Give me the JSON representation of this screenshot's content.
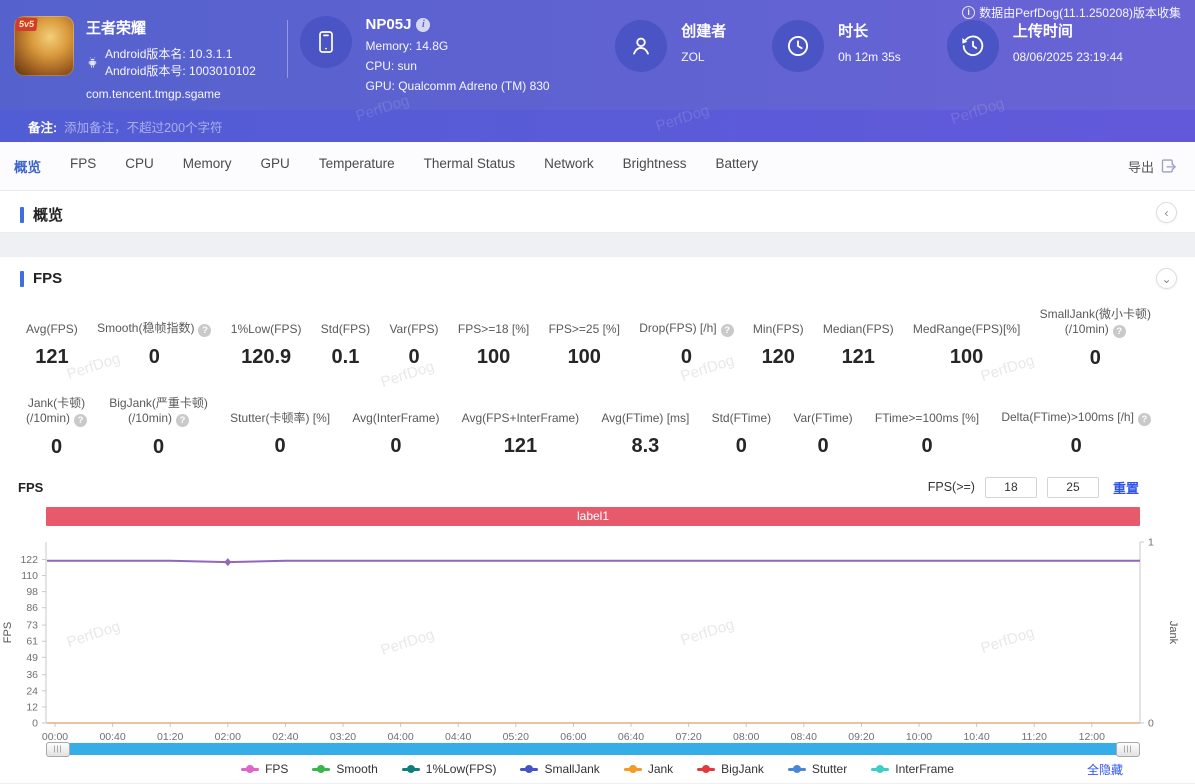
{
  "page": {
    "watermark": "PerfDog"
  },
  "header": {
    "app": {
      "name": "王者荣耀",
      "badge": "5v5",
      "android_version_name": "Android版本名: 10.3.1.1",
      "android_version_code": "Android版本号: 1003010102",
      "package": "com.tencent.tmgp.sgame"
    },
    "device": {
      "model": "NP05J",
      "memory": "Memory: 14.8G",
      "cpu": "CPU: sun",
      "gpu": "GPU: Qualcomm Adreno (TM) 830"
    },
    "creator": {
      "label": "创建者",
      "value": "ZOL"
    },
    "duration": {
      "label": "时长",
      "value": "0h 12m 35s"
    },
    "upload": {
      "label": "上传时间",
      "value": "08/06/2025 23:19:44"
    },
    "collect_note": "数据由PerfDog(11.1.250208)版本收集"
  },
  "note_bar": {
    "label": "备注:",
    "placeholder": "添加备注，不超过200个字符"
  },
  "tabs": {
    "items": [
      "概览",
      "FPS",
      "CPU",
      "Memory",
      "GPU",
      "Temperature",
      "Thermal Status",
      "Network",
      "Brightness",
      "Battery"
    ],
    "active": "概览",
    "export_label": "导出"
  },
  "sections": {
    "overview_title": "概览",
    "fps_title": "FPS"
  },
  "fps_stats_row1": [
    {
      "lines": [
        "Avg(FPS)"
      ],
      "help": false,
      "value": "121"
    },
    {
      "lines": [
        "Smooth(稳帧指数)"
      ],
      "help": true,
      "value": "0"
    },
    {
      "lines": [
        "1%Low(FPS)"
      ],
      "help": false,
      "value": "120.9"
    },
    {
      "lines": [
        "Std(FPS)"
      ],
      "help": false,
      "value": "0.1"
    },
    {
      "lines": [
        "Var(FPS)"
      ],
      "help": false,
      "value": "0"
    },
    {
      "lines": [
        "FPS>=18 [%]"
      ],
      "help": false,
      "value": "100"
    },
    {
      "lines": [
        "FPS>=25 [%]"
      ],
      "help": false,
      "value": "100"
    },
    {
      "lines": [
        "Drop(FPS) [/h]"
      ],
      "help": true,
      "value": "0"
    },
    {
      "lines": [
        "Min(FPS)"
      ],
      "help": false,
      "value": "120"
    },
    {
      "lines": [
        "Median(FPS)"
      ],
      "help": false,
      "value": "121"
    },
    {
      "lines": [
        "MedRange(FPS)[%]"
      ],
      "help": false,
      "value": "100"
    },
    {
      "lines": [
        "SmallJank(微小卡顿)",
        "(/10min)"
      ],
      "help": true,
      "value": "0"
    }
  ],
  "fps_stats_row2": [
    {
      "lines": [
        "Jank(卡顿)",
        "(/10min)"
      ],
      "help": true,
      "value": "0"
    },
    {
      "lines": [
        "BigJank(严重卡顿)",
        "(/10min)"
      ],
      "help": true,
      "value": "0"
    },
    {
      "lines": [
        "Stutter(卡顿率) [%]"
      ],
      "help": false,
      "value": "0"
    },
    {
      "lines": [
        "Avg(InterFrame)"
      ],
      "help": false,
      "value": "0"
    },
    {
      "lines": [
        "Avg(FPS+InterFrame)"
      ],
      "help": false,
      "value": "121"
    },
    {
      "lines": [
        "Avg(FTime) [ms]"
      ],
      "help": false,
      "value": "8.3"
    },
    {
      "lines": [
        "Std(FTime)"
      ],
      "help": false,
      "value": "0"
    },
    {
      "lines": [
        "Var(FTime)"
      ],
      "help": false,
      "value": "0"
    },
    {
      "lines": [
        "FTime>=100ms [%]"
      ],
      "help": false,
      "value": "0"
    },
    {
      "lines": [
        "Delta(FTime)>100ms [/h]"
      ],
      "help": true,
      "value": "0"
    }
  ],
  "fps_chart": {
    "title": "FPS",
    "threshold_label": "FPS(>=)",
    "threshold_values": [
      "18",
      "25"
    ],
    "reset_label": "重置",
    "hide_all_label": "全隐藏"
  },
  "chart_data": {
    "type": "line",
    "title": "FPS",
    "label_bar": "label1",
    "x_ticks": [
      "00:00",
      "00:40",
      "01:20",
      "02:00",
      "02:40",
      "03:20",
      "04:00",
      "04:40",
      "05:20",
      "06:00",
      "06:40",
      "07:20",
      "08:00",
      "08:40",
      "09:20",
      "10:00",
      "10:40",
      "11:20",
      "12:00"
    ],
    "y_left": {
      "label": "FPS",
      "ticks": [
        0,
        12,
        24,
        36,
        49,
        61,
        73,
        86,
        98,
        110,
        122
      ],
      "max": 135
    },
    "y_right": {
      "label": "Jank",
      "ticks": [
        0,
        1
      ],
      "max": 1
    },
    "grid": false,
    "series": [
      {
        "name": "FPS",
        "axis": "left",
        "color": "#9266bd",
        "values": [
          121,
          121,
          121,
          120,
          121,
          121,
          121,
          121,
          121,
          121,
          121,
          121,
          121,
          121,
          121,
          121,
          121,
          121,
          121
        ]
      },
      {
        "name": "Jank",
        "axis": "right",
        "color": "#e0b080",
        "values": [
          0,
          0,
          0,
          0,
          0,
          0,
          0,
          0,
          0,
          0,
          0,
          0,
          0,
          0,
          0,
          0,
          0,
          0,
          0
        ]
      }
    ],
    "legend": [
      {
        "name": "FPS",
        "color": "#e064c8"
      },
      {
        "name": "Smooth",
        "color": "#3cb44b"
      },
      {
        "name": "1%Low(FPS)",
        "color": "#0f7f7b"
      },
      {
        "name": "SmallJank",
        "color": "#4653c8"
      },
      {
        "name": "Jank",
        "color": "#f59a23"
      },
      {
        "name": "BigJank",
        "color": "#e4393c"
      },
      {
        "name": "Stutter",
        "color": "#4a86d8"
      },
      {
        "name": "InterFrame",
        "color": "#3ecfc4"
      }
    ],
    "legend_position": "bottom"
  }
}
